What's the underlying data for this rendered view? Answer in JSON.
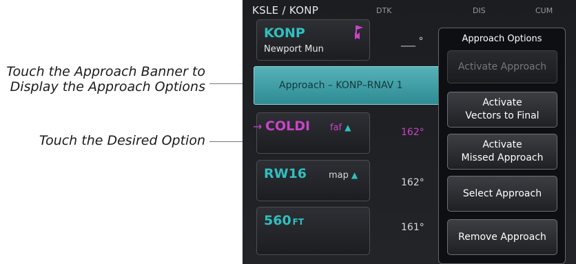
{
  "callouts": [
    {
      "lines": [
        "Touch the Approach Banner to",
        "Display the Approach Options"
      ]
    },
    {
      "lines": [
        "Touch the Desired Option"
      ]
    }
  ],
  "header": {
    "route": "KSLE / KONP",
    "columns": [
      "DTK",
      "DIS",
      "CUM"
    ]
  },
  "flight_plan": {
    "destination": {
      "id": "KONP",
      "name": "Newport Mun",
      "dtk": "___ °"
    },
    "approach_banner": "Approach – KONP–RNAV 1",
    "waypoints": [
      {
        "id": "COLDI",
        "tag": "faf",
        "dtk": "162°",
        "active": true
      },
      {
        "id": "RW16",
        "tag": "map",
        "dtk": "162°",
        "active": false
      },
      {
        "id": "560",
        "unit": "FT",
        "dtk": "161°",
        "active": false
      }
    ]
  },
  "approach_options": {
    "title": "Approach Options",
    "buttons": [
      {
        "lines": [
          "Activate Approach"
        ],
        "enabled": false
      },
      {
        "lines": [
          "Activate",
          "Vectors to Final"
        ],
        "enabled": true
      },
      {
        "lines": [
          "Activate",
          "Missed Approach"
        ],
        "enabled": true
      },
      {
        "lines": [
          "Select Approach"
        ],
        "enabled": true
      },
      {
        "lines": [
          "Remove Approach"
        ],
        "enabled": true
      }
    ]
  },
  "colors": {
    "waypoint_text": "#2fc0c0",
    "active_leg": "#c944c9",
    "banner": "#3f9ea6",
    "destination_flag": "#c944c9"
  },
  "icons": [
    "active-leg-arrow-icon",
    "destination-flag-icon",
    "up-triangle-icon"
  ]
}
